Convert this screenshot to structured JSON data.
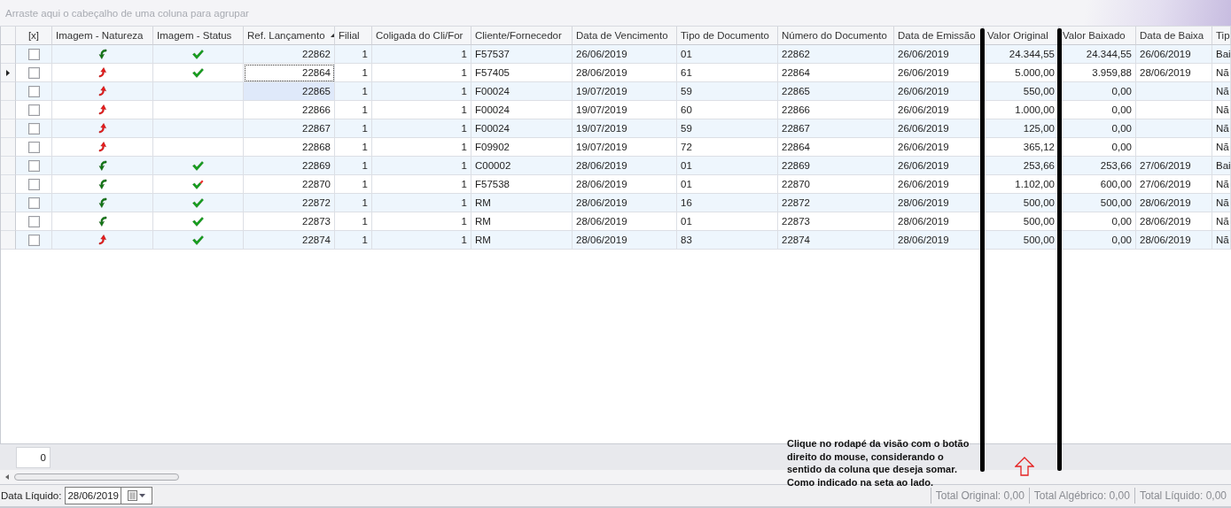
{
  "group_panel": {
    "placeholder": "Arraste aqui o cabeçalho de uma coluna para agrupar"
  },
  "columns": [
    {
      "label": "[x]",
      "sorted": false
    },
    {
      "label": "Imagem - Natureza",
      "sorted": false
    },
    {
      "label": "Imagem - Status",
      "sorted": false
    },
    {
      "label": "Ref. Lançamento",
      "sorted": true
    },
    {
      "label": "Filial",
      "sorted": false
    },
    {
      "label": "Coligada do Cli/For",
      "sorted": false
    },
    {
      "label": "Cliente/Fornecedor",
      "sorted": false
    },
    {
      "label": "Data de Vencimento",
      "sorted": false
    },
    {
      "label": "Tipo de Documento",
      "sorted": false
    },
    {
      "label": "Número do Documento",
      "sorted": false
    },
    {
      "label": "Data de Emissão",
      "sorted": false
    },
    {
      "label": "Valor Original",
      "sorted": false
    },
    {
      "label": "Valor Baixado",
      "sorted": false
    },
    {
      "label": "Data de Baixa",
      "sorted": false
    },
    {
      "label": "Tip",
      "sorted": false
    }
  ],
  "rows": [
    {
      "selected": false,
      "hovered": false,
      "checked": false,
      "nature_icon": {
        "kind": "incoming"
      },
      "status_icon": {
        "kind": "check"
      },
      "cells": [
        "22862",
        "1",
        "1",
        "F57537",
        "26/06/2019",
        "01",
        "22862",
        "26/06/2019",
        "24.344,55",
        "24.344,55",
        "26/06/2019",
        "Bai"
      ]
    },
    {
      "selected": true,
      "hovered": false,
      "checked": false,
      "nature_icon": {
        "kind": "outgoing"
      },
      "status_icon": {
        "kind": "check"
      },
      "cells": [
        "22864",
        "1",
        "1",
        "F57405",
        "28/06/2019",
        "61",
        "22864",
        "26/06/2019",
        "5.000,00",
        "3.959,88",
        "28/06/2019",
        "Nã"
      ]
    },
    {
      "selected": false,
      "hovered": true,
      "checked": false,
      "nature_icon": {
        "kind": "outgoing"
      },
      "cells": [
        "22865",
        "1",
        "1",
        "F00024",
        "19/07/2019",
        "59",
        "22865",
        "26/06/2019",
        "550,00",
        "0,00",
        null,
        "Nã"
      ]
    },
    {
      "selected": false,
      "hovered": false,
      "checked": false,
      "nature_icon": {
        "kind": "outgoing"
      },
      "cells": [
        "22866",
        "1",
        "1",
        "F00024",
        "19/07/2019",
        "60",
        "22866",
        "26/06/2019",
        "1.000,00",
        "0,00",
        null,
        "Nã"
      ]
    },
    {
      "selected": false,
      "hovered": false,
      "checked": false,
      "nature_icon": {
        "kind": "outgoing"
      },
      "cells": [
        "22867",
        "1",
        "1",
        "F00024",
        "19/07/2019",
        "59",
        "22867",
        "26/06/2019",
        "125,00",
        "0,00",
        null,
        "Nã"
      ]
    },
    {
      "selected": false,
      "hovered": false,
      "checked": false,
      "nature_icon": {
        "kind": "outgoing"
      },
      "cells": [
        "22868",
        "1",
        "1",
        "F09902",
        "19/07/2019",
        "72",
        "22864",
        "26/06/2019",
        "365,12",
        "0,00",
        null,
        "Nã"
      ]
    },
    {
      "selected": false,
      "hovered": false,
      "checked": false,
      "nature_icon": {
        "kind": "incoming"
      },
      "status_icon": {
        "kind": "check"
      },
      "cells": [
        "22869",
        "1",
        "1",
        "C00002",
        "28/06/2019",
        "01",
        "22869",
        "26/06/2019",
        "253,66",
        "253,66",
        "27/06/2019",
        "Bai"
      ]
    },
    {
      "selected": false,
      "hovered": false,
      "checked": false,
      "nature_icon": {
        "kind": "incoming"
      },
      "status_icon": {
        "kind": "partial-check"
      },
      "cells": [
        "22870",
        "1",
        "1",
        "F57538",
        "28/06/2019",
        "01",
        "22870",
        "26/06/2019",
        "1.102,00",
        "600,00",
        "27/06/2019",
        "Nã"
      ]
    },
    {
      "selected": false,
      "hovered": false,
      "checked": false,
      "nature_icon": {
        "kind": "incoming"
      },
      "status_icon": {
        "kind": "check"
      },
      "cells": [
        "22872",
        "1",
        "1",
        "RM",
        "28/06/2019",
        "16",
        "22872",
        "28/06/2019",
        "500,00",
        "500,00",
        "28/06/2019",
        "Nã"
      ]
    },
    {
      "selected": false,
      "hovered": false,
      "checked": false,
      "nature_icon": {
        "kind": "incoming"
      },
      "status_icon": {
        "kind": "check"
      },
      "cells": [
        "22873",
        "1",
        "1",
        "RM",
        "28/06/2019",
        "01",
        "22873",
        "28/06/2019",
        "500,00",
        "0,00",
        "28/06/2019",
        "Nã"
      ]
    },
    {
      "selected": false,
      "hovered": false,
      "checked": false,
      "nature_icon": {
        "kind": "outgoing"
      },
      "status_icon": {
        "kind": "check"
      },
      "cells": [
        "22874",
        "1",
        "1",
        "RM",
        "28/06/2019",
        "83",
        "22874",
        "28/06/2019",
        "500,00",
        "0,00",
        "28/06/2019",
        "Nã"
      ]
    }
  ],
  "footer": {
    "count": "0"
  },
  "annotation": {
    "note": "Clique no rodapé da visão com o botão\ndireito do mouse, considerando o\nsentido da coluna que deseja somar.\nComo indicado na seta ao lado."
  },
  "status_bar": {
    "date_label": "Data Líquido:",
    "date_value": "28/06/2019",
    "totals": [
      "Total Original: 0,00",
      "Total Algébrico: 0,00",
      "Total Líquido: 0,00"
    ]
  }
}
